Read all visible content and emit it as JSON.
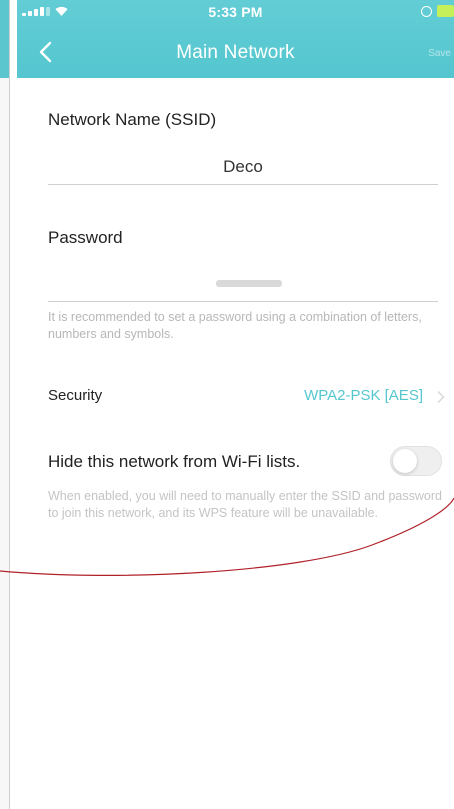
{
  "status_bar": {
    "time": "5:33 PM",
    "signal_icon": "cellular-signal-icon",
    "wifi_icon": "wifi-icon",
    "alarm_icon": "alarm-icon",
    "battery_icon": "battery-icon",
    "battery_color": "#c6f05a"
  },
  "nav": {
    "back_icon": "chevron-left-icon",
    "title": "Main Network",
    "save_label": "Save"
  },
  "form": {
    "ssid_label": "Network Name (SSID)",
    "ssid_value": "Deco",
    "password_label": "Password",
    "password_hint": "It is recommended to set a password using a combination of letters, numbers and symbols.",
    "security_label": "Security",
    "security_value": "WPA2-PSK [AES]",
    "hide_network_label": "Hide this network from Wi-Fi lists.",
    "hide_network_enabled": false,
    "hide_network_description": "When enabled, you will need to manually enter the SSID and password to join this network, and its WPS feature will be unavailable."
  },
  "colors": {
    "header": "#5ac9d2",
    "accent": "#55c7cf",
    "annotation": "#b0222a"
  }
}
